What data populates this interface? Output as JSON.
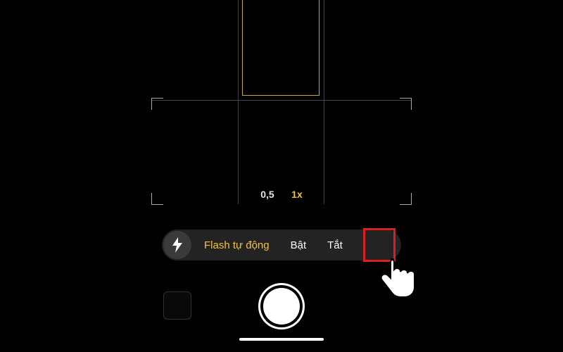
{
  "zoom": {
    "wide": "0,5",
    "default": "1x"
  },
  "flash": {
    "auto_label": "Flash tự động",
    "on_label": "Bật",
    "off_label": "Tắt",
    "selected": "off"
  },
  "colors": {
    "accent_yellow": "#f2c23a",
    "highlight_red": "#d91f1f"
  }
}
